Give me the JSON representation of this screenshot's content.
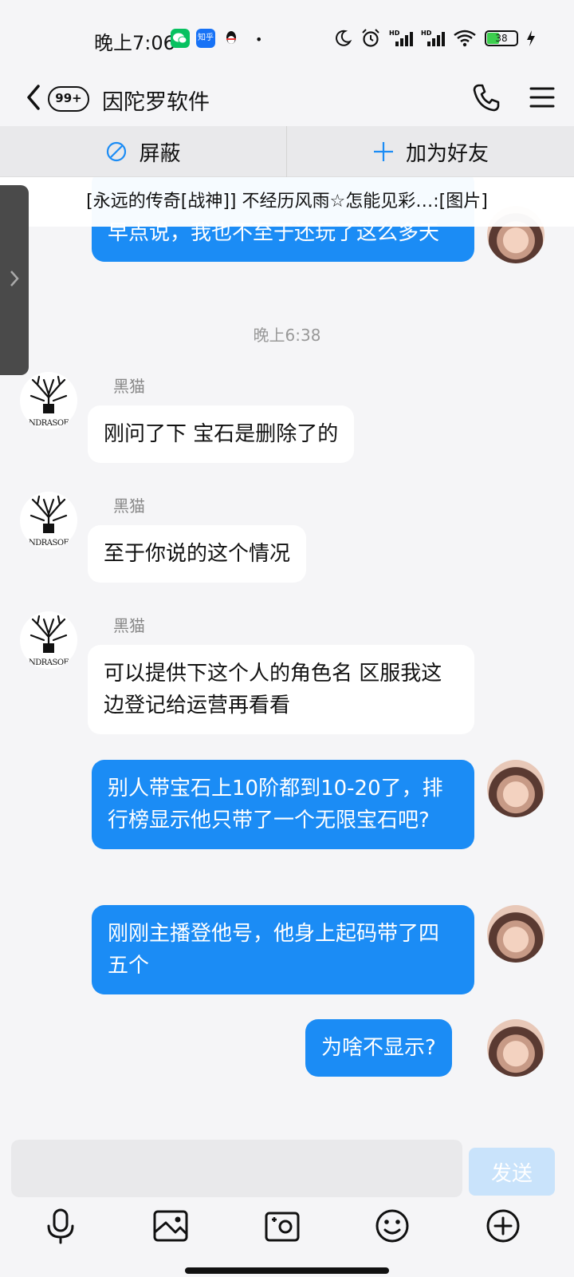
{
  "status_bar": {
    "time": "晚上7:06",
    "apps": [
      {
        "name": "wechat",
        "color": "#07c160"
      },
      {
        "name": "zhihu",
        "label": "知乎",
        "color": "#1772f6"
      },
      {
        "name": "qq",
        "color": "#111111"
      }
    ],
    "battery": "38",
    "icons": [
      "moon-icon",
      "alarm-icon",
      "signal-hd-icon",
      "signal-hd-icon",
      "wifi-icon",
      "battery-icon",
      "charging-icon"
    ]
  },
  "header": {
    "unread_badge": "99+",
    "title": "因陀罗软件"
  },
  "actions": {
    "block_label": "屏蔽",
    "add_friend_label": "加为好友"
  },
  "pinned": {
    "text": "[永远的传奇[战神]] 不经历风雨☆怎能见彩…:[图片]"
  },
  "chat": {
    "timestamp": "晚上6:38",
    "other_avatar_text": "NDRASOF",
    "messages": [
      {
        "side": "mine",
        "text": "早点说，我也不至于还玩了这么多天"
      },
      {
        "side": "other",
        "sender": "黑猫",
        "text": "刚问了下 宝石是删除了的"
      },
      {
        "side": "other",
        "sender": "黑猫",
        "text": "至于你说的这个情况"
      },
      {
        "side": "other",
        "sender": "黑猫",
        "text": "可以提供下这个人的角色名 区服我这边登记给运营再看看"
      },
      {
        "side": "mine",
        "text": "别人带宝石上10阶都到10-20了，排行榜显示他只带了一个无限宝石吧?"
      },
      {
        "side": "mine",
        "text": "刚刚主播登他号，他身上起码带了四五个"
      },
      {
        "side": "mine",
        "text": "为啥不显示?"
      }
    ]
  },
  "composer": {
    "input_value": "",
    "send_label": "发送"
  },
  "colors": {
    "accent": "#1b8cf5",
    "send_disabled": "#c9e3fb",
    "background": "#f5f5f7"
  }
}
